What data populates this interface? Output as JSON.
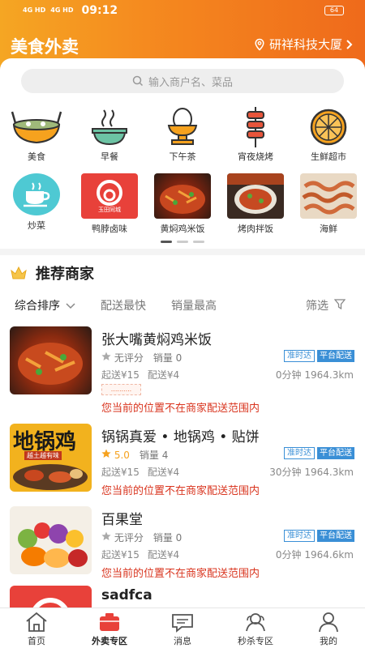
{
  "status": {
    "signal1": "4G HD",
    "signal2": "4G HD",
    "time": "09:12",
    "battery": "64"
  },
  "header": {
    "title": "美食外卖",
    "location": "研祥科技大厦"
  },
  "search": {
    "placeholder": "输入商户名、菜品"
  },
  "categories_row1": [
    {
      "label": "美食",
      "icon": "noodle-bowl-icon"
    },
    {
      "label": "早餐",
      "icon": "steaming-bowl-icon"
    },
    {
      "label": "下午茶",
      "icon": "egg-cup-icon"
    },
    {
      "label": "宵夜烧烤",
      "icon": "skewer-icon"
    },
    {
      "label": "生鲜超市",
      "icon": "orange-slice-icon"
    }
  ],
  "categories_row2": [
    {
      "label": "炒菜",
      "icon": "coffee-cup-icon"
    },
    {
      "label": "鸭脖卤味",
      "icon": "brand-logo-icon",
      "brand": "玉田同城"
    },
    {
      "label": "黄焖鸡米饭",
      "icon": "food-photo"
    },
    {
      "label": "烤肉拌饭",
      "icon": "food-photo"
    },
    {
      "label": "海鲜",
      "icon": "food-photo"
    }
  ],
  "recommend": {
    "title": "推荐商家"
  },
  "sort": {
    "comprehensive": "综合排序",
    "delivery_fast": "配送最快",
    "sales_high": "销量最高",
    "filter": "筛选"
  },
  "shops": [
    {
      "name": "张大嘴黄焖鸡米饭",
      "rating": "无评分",
      "sales": "销量 0",
      "min_order": "起送¥15",
      "delivery_fee": "配送¥4",
      "distance": "0分钟 1964.3km",
      "badge1": "准时达",
      "badge2": "平台配送",
      "promo": "..........",
      "warning": "您当前的位置不在商家配送范围内"
    },
    {
      "name": "锅锅真爱 • 地锅鸡 • 贴饼",
      "rating": "5.0",
      "sales": "销量 4",
      "min_order": "起送¥15",
      "delivery_fee": "配送¥4",
      "distance": "30分钟 1964.3km",
      "badge1": "准时达",
      "badge2": "平台配送",
      "warning": "您当前的位置不在商家配送范围内",
      "img_text": "地锅鸡",
      "img_sub": "越土越有味"
    },
    {
      "name": "百果堂",
      "rating": "无评分",
      "sales": "销量 0",
      "min_order": "起送¥15",
      "delivery_fee": "配送¥4",
      "distance": "0分钟 1964.6km",
      "badge1": "准时达",
      "badge2": "平台配送",
      "warning": "您当前的位置不在商家配送范围内"
    },
    {
      "name": "sadfca"
    }
  ],
  "tabbar": [
    {
      "label": "首页",
      "icon": "home-icon"
    },
    {
      "label": "外卖专区",
      "icon": "takeout-icon"
    },
    {
      "label": "消息",
      "icon": "message-icon"
    },
    {
      "label": "秒杀专区",
      "icon": "flash-sale-icon"
    },
    {
      "label": "我的",
      "icon": "user-icon"
    }
  ],
  "colors": {
    "accent": "#f58a1f",
    "warning": "#d9351f",
    "badge": "#3a8fd6"
  }
}
